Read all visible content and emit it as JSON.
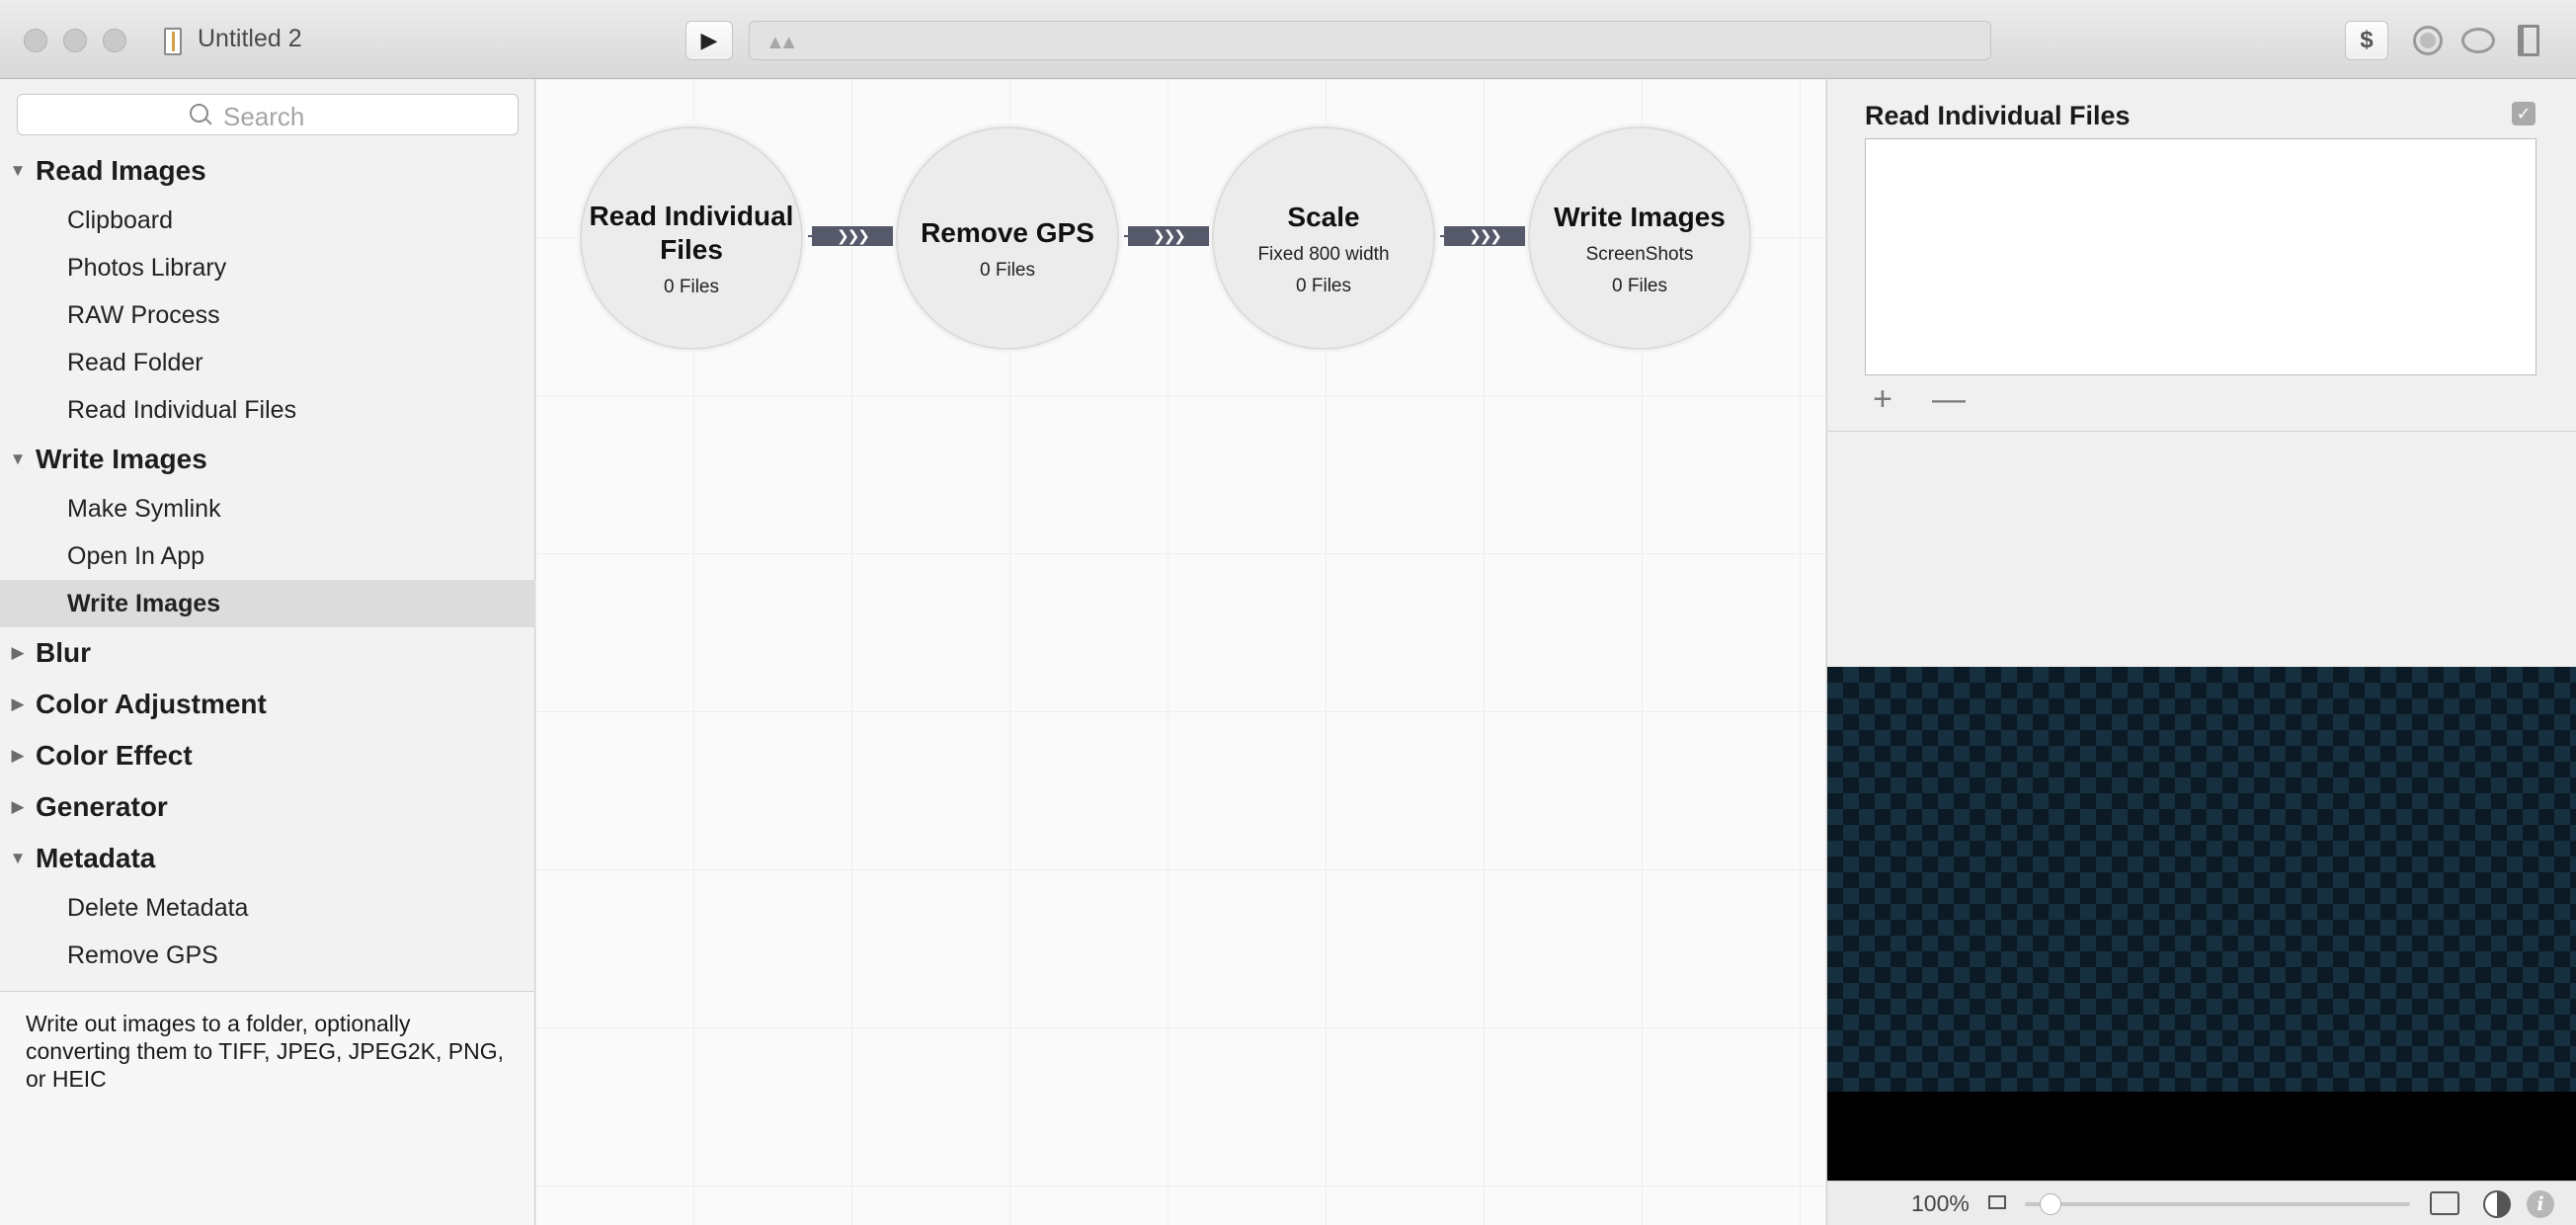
{
  "window": {
    "title": "Untitled 2",
    "play_symbol": "▶",
    "mountain_symbol": "▲▲",
    "dollar_label": "$"
  },
  "sidebar": {
    "search_placeholder": "Search",
    "categories": [
      {
        "label": "Read Images",
        "expanded": true,
        "items": [
          "Clipboard",
          "Photos Library",
          "RAW Process",
          "Read Folder",
          "Read Individual Files"
        ]
      },
      {
        "label": "Write Images",
        "expanded": true,
        "items": [
          "Make Symlink",
          "Open In App",
          "Write Images"
        ],
        "selected_item": "Write Images"
      },
      {
        "label": "Blur",
        "expanded": false
      },
      {
        "label": "Color Adjustment",
        "expanded": false
      },
      {
        "label": "Color Effect",
        "expanded": false
      },
      {
        "label": "Generator",
        "expanded": false
      },
      {
        "label": "Metadata",
        "expanded": true,
        "items": [
          "Delete Metadata",
          "Remove GPS"
        ]
      }
    ],
    "description": "Write out images to a folder, optionally converting them to TIFF, JPEG, JPEG2K, PNG, or HEIC"
  },
  "pipeline": {
    "nodes": [
      {
        "title": "Read Individual Files",
        "subtitle": "",
        "count": "0 Files"
      },
      {
        "title": "Remove GPS",
        "subtitle": "",
        "count": "0 Files"
      },
      {
        "title": "Scale",
        "subtitle": "Fixed 800 width",
        "count": "0 Files"
      },
      {
        "title": "Write Images",
        "subtitle": "ScreenShots",
        "count": "0 Files"
      }
    ],
    "connector_glyph": "❯❯❯"
  },
  "inspector": {
    "title": "Read Individual Files",
    "enabled_check": "✓",
    "add_label": "+",
    "remove_label": "—",
    "zoom": "100%",
    "zoom_slider_value": 0.04,
    "info_label": "i"
  }
}
